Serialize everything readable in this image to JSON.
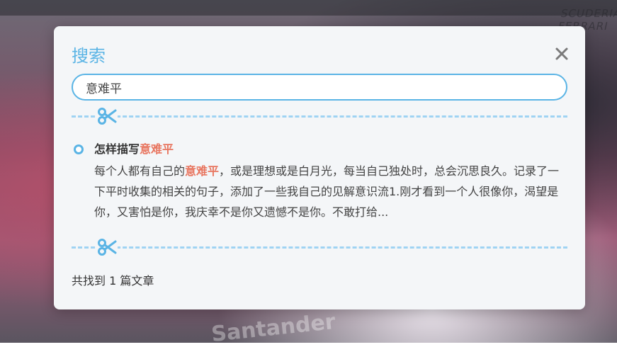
{
  "background": {
    "brand_text": "SCUDERIA FERRARI",
    "sponsor_text": "Santander"
  },
  "dialog": {
    "title": "搜索",
    "close_icon": "close-icon",
    "search": {
      "value": "意难平",
      "placeholder": ""
    },
    "divider_icon": "scissors-icon",
    "results": [
      {
        "title_prefix": "怎样描写",
        "title_highlight": "意难平",
        "excerpt_before": "每个人都有自己的",
        "excerpt_highlight": "意难平",
        "excerpt_after": "，或是理想或是白月光，每当自己独处时，总会沉思良久。记录了一下平时收集的相关的句子，添加了一些我自己的见解意识流1.刚才看到一个人很像你，渴望是你，又害怕是你，我庆幸不是你又遗憾不是你。不敢打给..."
      }
    ],
    "summary": "共找到 1 篇文章"
  },
  "colors": {
    "accent": "#5ab4e5",
    "highlight": "#e8755f",
    "divider": "#9fd3f3",
    "panel": "#f4f6f8"
  }
}
